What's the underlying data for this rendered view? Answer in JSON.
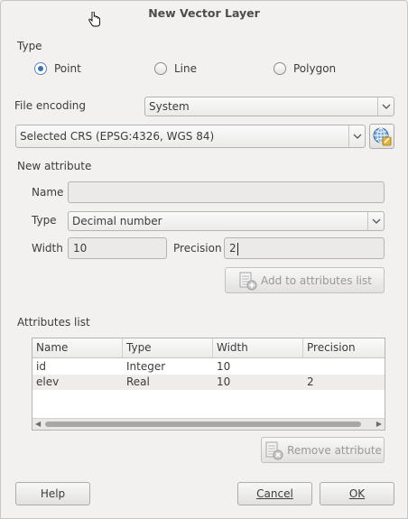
{
  "window": {
    "title": "New Vector Layer"
  },
  "type_group": {
    "label": "Type",
    "options": [
      {
        "label": "Point",
        "checked": true
      },
      {
        "label": "Line",
        "checked": false
      },
      {
        "label": "Polygon",
        "checked": false
      }
    ]
  },
  "file_encoding": {
    "label": "File encoding",
    "value": "System"
  },
  "crs": {
    "value": "Selected CRS (EPSG:4326, WGS 84)"
  },
  "new_attribute": {
    "label": "New attribute",
    "name_label": "Name",
    "name_value": "",
    "type_label": "Type",
    "type_value": "Decimal number",
    "width_label": "Width",
    "width_value": "10",
    "precision_label": "Precision",
    "precision_value": "2",
    "add_button": "Add to attributes list"
  },
  "attributes_list": {
    "label": "Attributes list",
    "columns": [
      "Name",
      "Type",
      "Width",
      "Precision"
    ],
    "rows": [
      [
        "id",
        "Integer",
        "10",
        ""
      ],
      [
        "elev",
        "Real",
        "10",
        "2"
      ]
    ],
    "remove_button": "Remove attribute"
  },
  "buttons": {
    "help": "Help",
    "cancel": "Cancel",
    "ok": "OK"
  },
  "colors": {
    "accent": "#3f72af",
    "background": "#f2f1f0"
  }
}
